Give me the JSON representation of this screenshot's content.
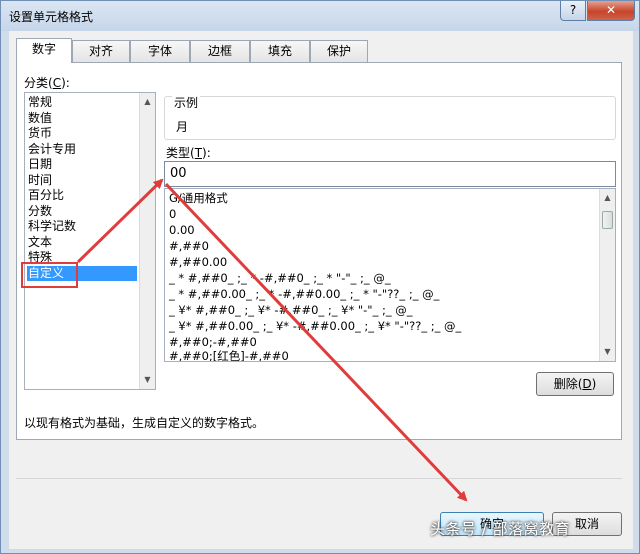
{
  "window": {
    "title": "设置单元格格式",
    "help_label": "?",
    "close_label": "✕"
  },
  "tabs": [
    {
      "label": "数字",
      "active": true
    },
    {
      "label": "对齐"
    },
    {
      "label": "字体"
    },
    {
      "label": "边框"
    },
    {
      "label": "填充"
    },
    {
      "label": "保护"
    }
  ],
  "category": {
    "label": "分类(",
    "hotkey": "C",
    "label_end": "):",
    "items": [
      "常规",
      "数值",
      "货币",
      "会计专用",
      "日期",
      "时间",
      "百分比",
      "分数",
      "科学记数",
      "文本",
      "特殊",
      "自定义"
    ],
    "selected": "自定义"
  },
  "sample": {
    "label": "示例",
    "value": "月"
  },
  "type": {
    "label": "类型(",
    "hotkey": "T",
    "label_end": "):",
    "value": "00"
  },
  "formats": [
    "G/通用格式",
    "0",
    "0.00",
    "#,##0",
    "#,##0.00",
    "_ * #,##0_ ;_ * -#,##0_ ;_ * \"-\"_ ;_ @_",
    "_ * #,##0.00_ ;_ * -#,##0.00_ ;_ * \"-\"??_ ;_ @_",
    "_ ¥* #,##0_ ;_ ¥* -#,##0_ ;_ ¥* \"-\"_ ;_ @_",
    "_ ¥* #,##0.00_ ;_ ¥* -#,##0.00_ ;_ ¥* \"-\"??_ ;_ @_",
    "#,##0;-#,##0",
    "#,##0;[红色]-#,##0"
  ],
  "delete_button": {
    "label": "删除(",
    "hotkey": "D",
    "label_end": ")"
  },
  "hint": "以现有格式为基础，生成自定义的数字格式。",
  "ok_button": {
    "label": "确定"
  },
  "cancel_button": {
    "label": "取消"
  },
  "watermark": "头条号 / 部落窝教育",
  "colors": {
    "annotation": "#e03c3c",
    "selection": "#3399ff"
  }
}
